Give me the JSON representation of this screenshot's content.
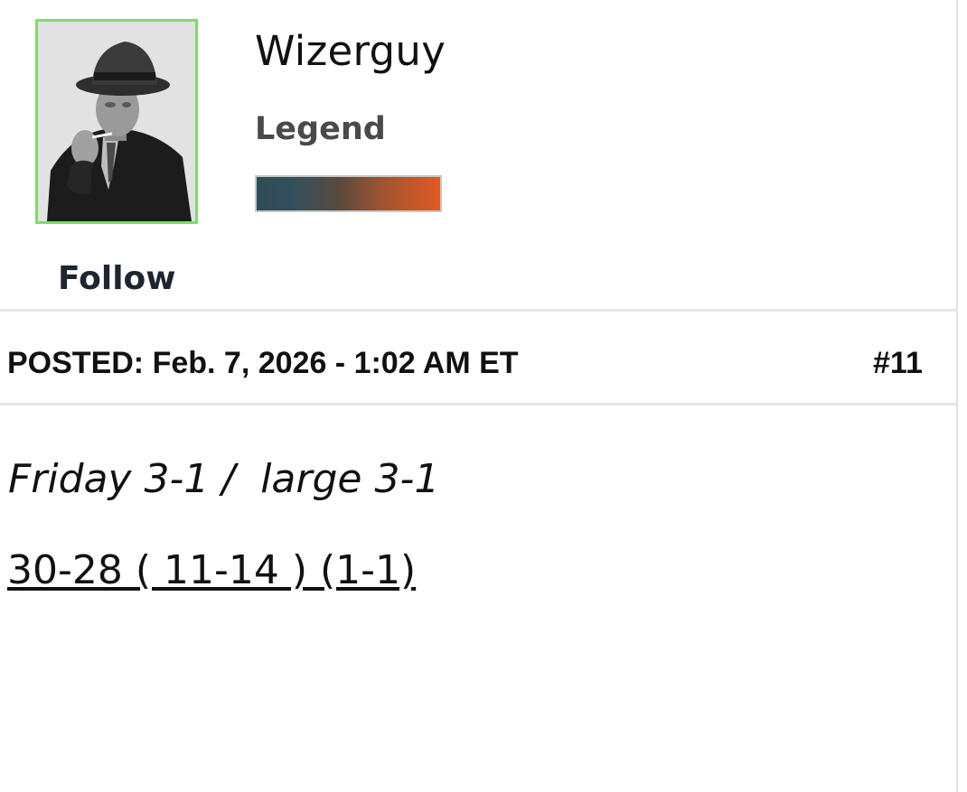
{
  "profile": {
    "username": "Wizerguy",
    "rank": "Legend",
    "follow_label": "Follow",
    "avatar_border_color": "#7ddc6a",
    "rank_bar_colors": [
      "#2e4b58",
      "#e05a25"
    ]
  },
  "post": {
    "posted_label": "POSTED: Feb. 7, 2026 - 1:02 AM ET",
    "number": "#11",
    "lines": [
      "Friday 3-1 /  large 3-1",
      "30-28 ( 11-14 ) (1-1)"
    ]
  }
}
